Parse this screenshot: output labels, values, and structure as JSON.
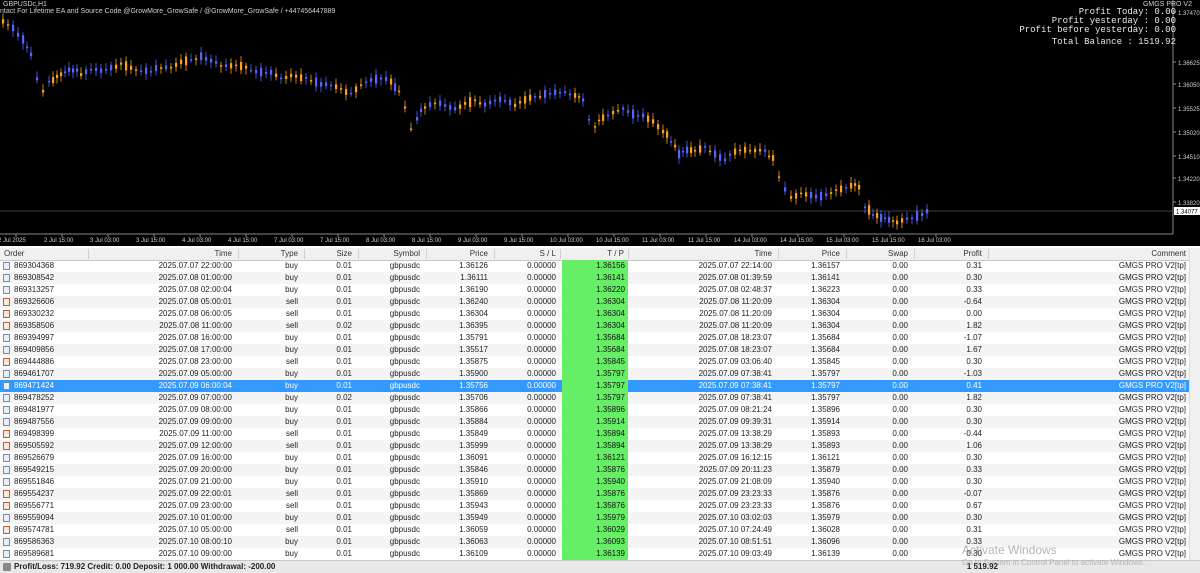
{
  "chart": {
    "symbol": "GBPUSDc,H1",
    "contact": "ntact For Lifetime EA and Source Code @GrowMore_GrowSafe / @GrowMore_GrowSafe / +447456447889",
    "ea_name": "GMGS PRO V2",
    "profit_today": "Profit Today: 0.00",
    "profit_yesterday": "Profit yesterday : 0.00",
    "profit_before": "Profit before yesterday: 0.00",
    "total_balance": "Total Balance : 1519.92",
    "current_price": "1.34077",
    "bull_color": "#ffa020",
    "bear_color": "#5566ff",
    "price_levels": [
      "1.37470",
      "1.36625",
      "1.36050",
      "1.35525",
      "1.35020",
      "1.34510",
      "1.34220",
      "1.33820"
    ],
    "time_labels": [
      "2 Jul 2025",
      "2 Jul 15:00",
      "3 Jul 03:00",
      "3 Jul 15:00",
      "4 Jul 03:00",
      "4 Jul 15:00",
      "7 Jul 03:00",
      "7 Jul 15:00",
      "8 Jul 03:00",
      "8 Jul 15:00",
      "9 Jul 03:00",
      "9 Jul 15:00",
      "10 Jul 03:00",
      "10 Jul 15:00",
      "11 Jul 03:00",
      "11 Jul 15:00",
      "14 Jul 03:00",
      "14 Jul 15:00",
      "15 Jul 03:00",
      "15 Jul 15:00",
      "16 Jul 03:00"
    ]
  },
  "table": {
    "headers": [
      "Order",
      "Time",
      "Type",
      "Size",
      "Symbol",
      "Price",
      "S / L",
      "T / P",
      "Time",
      "Price",
      "Swap",
      "Profit",
      "Comment"
    ],
    "rows": [
      [
        "869304368",
        "2025.07.07 22:00:00",
        "buy",
        "0.01",
        "gbpusdc",
        "1.36126",
        "0.00000",
        "1.36156",
        "2025.07.07 22:14:00",
        "1.36157",
        "0.00",
        "0.31",
        "GMGS PRO V2[tp]"
      ],
      [
        "869308542",
        "2025.07.08 01:00:00",
        "buy",
        "0.01",
        "gbpusdc",
        "1.36111",
        "0.00000",
        "1.36141",
        "2025.07.08 01:39:59",
        "1.36141",
        "0.00",
        "0.30",
        "GMGS PRO V2[tp]"
      ],
      [
        "869313257",
        "2025.07.08 02:00:04",
        "buy",
        "0.01",
        "gbpusdc",
        "1.36190",
        "0.00000",
        "1.36220",
        "2025.07.08 02:48:37",
        "1.36223",
        "0.00",
        "0.33",
        "GMGS PRO V2[tp]"
      ],
      [
        "869326606",
        "2025.07.08 05:00:01",
        "sell",
        "0.01",
        "gbpusdc",
        "1.36240",
        "0.00000",
        "1.36304",
        "2025.07.08 11:20:09",
        "1.36304",
        "0.00",
        "-0.64",
        "GMGS PRO V2[tp]"
      ],
      [
        "869330232",
        "2025.07.08 06:00:05",
        "sell",
        "0.01",
        "gbpusdc",
        "1.36304",
        "0.00000",
        "1.36304",
        "2025.07.08 11:20:09",
        "1.36304",
        "0.00",
        "0.00",
        "GMGS PRO V2[tp]"
      ],
      [
        "869358506",
        "2025.07.08 11:00:00",
        "sell",
        "0.02",
        "gbpusdc",
        "1.36395",
        "0.00000",
        "1.36304",
        "2025.07.08 11:20:09",
        "1.36304",
        "0.00",
        "1.82",
        "GMGS PRO V2[tp]"
      ],
      [
        "869394997",
        "2025.07.08 16:00:00",
        "buy",
        "0.01",
        "gbpusdc",
        "1.35791",
        "0.00000",
        "1.35684",
        "2025.07.08 18:23:07",
        "1.35684",
        "0.00",
        "-1.07",
        "GMGS PRO V2[tp]"
      ],
      [
        "869409856",
        "2025.07.08 17:00:00",
        "buy",
        "0.01",
        "gbpusdc",
        "1.35517",
        "0.00000",
        "1.35684",
        "2025.07.08 18:23:07",
        "1.35684",
        "0.00",
        "1.67",
        "GMGS PRO V2[tp]"
      ],
      [
        "869444886",
        "2025.07.08 23:00:00",
        "sell",
        "0.01",
        "gbpusdc",
        "1.35875",
        "0.00000",
        "1.35845",
        "2025.07.09 03:06:40",
        "1.35845",
        "0.00",
        "0.30",
        "GMGS PRO V2[tp]"
      ],
      [
        "869461707",
        "2025.07.09 05:00:00",
        "buy",
        "0.01",
        "gbpusdc",
        "1.35900",
        "0.00000",
        "1.35797",
        "2025.07.09 07:38:41",
        "1.35797",
        "0.00",
        "-1.03",
        "GMGS PRO V2[tp]"
      ],
      [
        "869471424",
        "2025.07.09 06:00:04",
        "buy",
        "0.01",
        "gbpusdc",
        "1.35756",
        "0.00000",
        "1.35797",
        "2025.07.09 07:38:41",
        "1.35797",
        "0.00",
        "0.41",
        "GMGS PRO V2[tp]"
      ],
      [
        "869478252",
        "2025.07.09 07:00:00",
        "buy",
        "0.02",
        "gbpusdc",
        "1.35706",
        "0.00000",
        "1.35797",
        "2025.07.09 07:38:41",
        "1.35797",
        "0.00",
        "1.82",
        "GMGS PRO V2[tp]"
      ],
      [
        "869481977",
        "2025.07.09 08:00:00",
        "buy",
        "0.01",
        "gbpusdc",
        "1.35866",
        "0.00000",
        "1.35896",
        "2025.07.09 08:21:24",
        "1.35896",
        "0.00",
        "0.30",
        "GMGS PRO V2[tp]"
      ],
      [
        "869487556",
        "2025.07.09 09:00:00",
        "buy",
        "0.01",
        "gbpusdc",
        "1.35884",
        "0.00000",
        "1.35914",
        "2025.07.09 09:39:31",
        "1.35914",
        "0.00",
        "0.30",
        "GMGS PRO V2[tp]"
      ],
      [
        "869498399",
        "2025.07.09 11:00:00",
        "sell",
        "0.01",
        "gbpusdc",
        "1.35849",
        "0.00000",
        "1.35894",
        "2025.07.09 13:38:29",
        "1.35893",
        "0.00",
        "-0.44",
        "GMGS PRO V2[tp]"
      ],
      [
        "869505592",
        "2025.07.09 12:00:00",
        "sell",
        "0.01",
        "gbpusdc",
        "1.35999",
        "0.00000",
        "1.35894",
        "2025.07.09 13:38:29",
        "1.35893",
        "0.00",
        "1.06",
        "GMGS PRO V2[tp]"
      ],
      [
        "869526679",
        "2025.07.09 16:00:00",
        "buy",
        "0.01",
        "gbpusdc",
        "1.36091",
        "0.00000",
        "1.36121",
        "2025.07.09 16:12:15",
        "1.36121",
        "0.00",
        "0.30",
        "GMGS PRO V2[tp]"
      ],
      [
        "869549215",
        "2025.07.09 20:00:00",
        "buy",
        "0.01",
        "gbpusdc",
        "1.35846",
        "0.00000",
        "1.35876",
        "2025.07.09 20:11:23",
        "1.35879",
        "0.00",
        "0.33",
        "GMGS PRO V2[tp]"
      ],
      [
        "869551846",
        "2025.07.09 21:00:00",
        "buy",
        "0.01",
        "gbpusdc",
        "1.35910",
        "0.00000",
        "1.35940",
        "2025.07.09 21:08:09",
        "1.35940",
        "0.00",
        "0.30",
        "GMGS PRO V2[tp]"
      ],
      [
        "869554237",
        "2025.07.09 22:00:01",
        "sell",
        "0.01",
        "gbpusdc",
        "1.35869",
        "0.00000",
        "1.35876",
        "2025.07.09 23:23:33",
        "1.35876",
        "0.00",
        "-0.07",
        "GMGS PRO V2[tp]"
      ],
      [
        "869556771",
        "2025.07.09 23:00:00",
        "sell",
        "0.01",
        "gbpusdc",
        "1.35943",
        "0.00000",
        "1.35876",
        "2025.07.09 23:23:33",
        "1.35876",
        "0.00",
        "0.67",
        "GMGS PRO V2[tp]"
      ],
      [
        "869559094",
        "2025.07.10 01:00:00",
        "buy",
        "0.01",
        "gbpusdc",
        "1.35949",
        "0.00000",
        "1.35979",
        "2025.07.10 03:02:03",
        "1.35979",
        "0.00",
        "0.30",
        "GMGS PRO V2[tp]"
      ],
      [
        "869574781",
        "2025.07.10 05:00:00",
        "sell",
        "0.01",
        "gbpusdc",
        "1.36059",
        "0.00000",
        "1.36029",
        "2025.07.10 07:24:49",
        "1.36028",
        "0.00",
        "0.31",
        "GMGS PRO V2[tp]"
      ],
      [
        "869586363",
        "2025.07.10 08:00:10",
        "buy",
        "0.01",
        "gbpusdc",
        "1.36063",
        "0.00000",
        "1.36093",
        "2025.07.10 08:51:51",
        "1.36096",
        "0.00",
        "0.33",
        "GMGS PRO V2[tp]"
      ],
      [
        "869589681",
        "2025.07.10 09:00:00",
        "buy",
        "0.01",
        "gbpusdc",
        "1.36109",
        "0.00000",
        "1.36139",
        "2025.07.10 09:03:49",
        "1.36139",
        "0.00",
        "0.30",
        "GMGS PRO V2[tp]"
      ]
    ],
    "selected_index": 10
  },
  "footer": {
    "summary": "Profit/Loss: 719.92  Credit: 0.00  Deposit: 1 000.00  Withdrawal: -200.00",
    "total": "1 519.92"
  },
  "watermark": {
    "line1": "Activate Windows",
    "line2": "Go to System in Control Panel to activate Windows."
  }
}
